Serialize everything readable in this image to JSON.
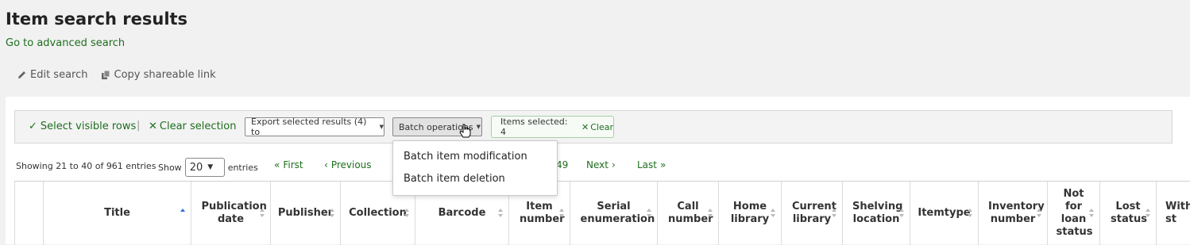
{
  "page": {
    "title": "Item search results",
    "advanced_link": "Go to advanced search"
  },
  "toolbar": {
    "edit_search": "Edit search",
    "copy_link": "Copy shareable link"
  },
  "actions": {
    "select_visible": "Select visible rows",
    "separator": "|",
    "clear_selection": "Clear selection",
    "export_label": "Export selected results (4) to",
    "batch_label": "Batch operations",
    "items_selected": "Items selected: 4",
    "clear": "Clear"
  },
  "batch_menu": {
    "items": [
      "Batch item modification",
      "Batch item deletion"
    ]
  },
  "pagination": {
    "showing": "Showing 21 to 40 of 961 entries",
    "show_label": "Show",
    "page_size": "20",
    "entries_label": "entries",
    "first": "First",
    "previous": "Previous",
    "page_fragment": "49",
    "next": "Next",
    "last": "Last"
  },
  "table": {
    "columns": [
      "Title",
      "Publication date",
      "Publisher",
      "Collection",
      "Barcode",
      "Item number",
      "Serial enumeration",
      "Call number",
      "Home library",
      "Current library",
      "Shelving location",
      "Itemtype",
      "Inventory number",
      "Not for loan status",
      "Lost status",
      "With st"
    ],
    "sorted_column": "Title",
    "sort_direction": "ascending"
  },
  "colors": {
    "link_green": "#1e6e1e",
    "sort_active": "#2f6fd6"
  }
}
